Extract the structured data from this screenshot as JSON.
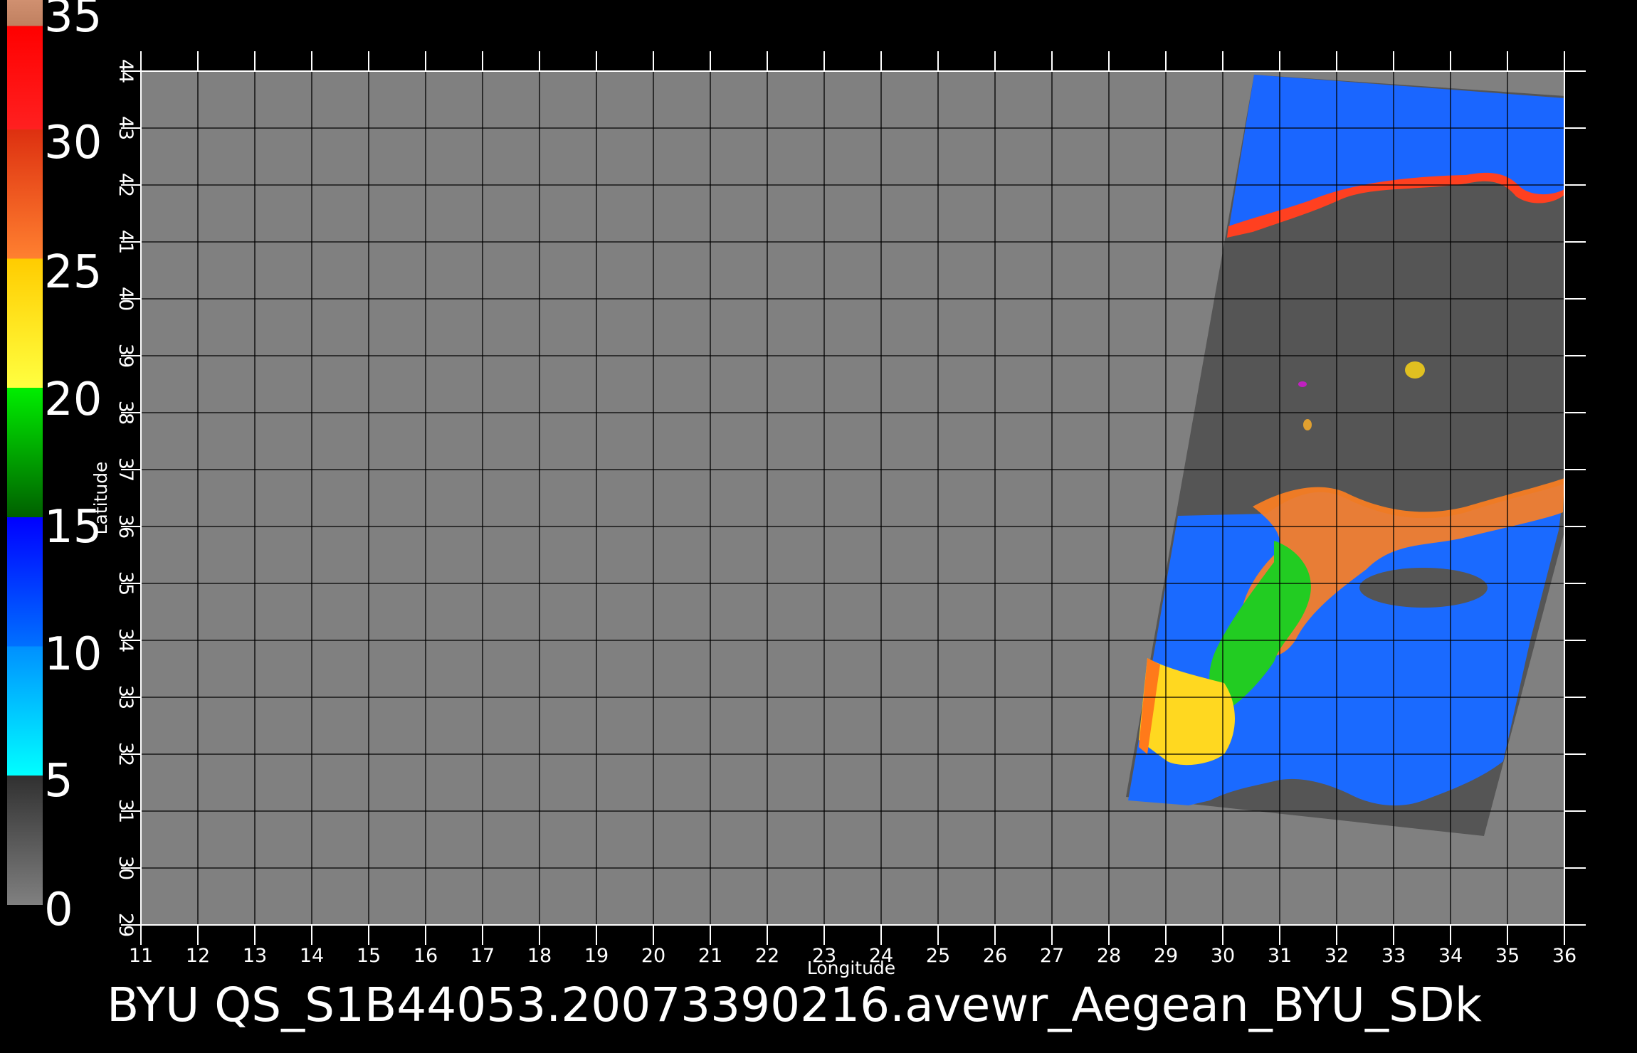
{
  "title": "BYU  QS_S1B44053.20073390216.avewr_Aegean_BYU_SDk",
  "map": {
    "xlabel": "Longitude",
    "ylabel": "Latitude",
    "lon_range": [
      11,
      36
    ],
    "lat_range": [
      29,
      44
    ],
    "lon_ticks": [
      "11",
      "12",
      "13",
      "14",
      "15",
      "16",
      "17",
      "18",
      "19",
      "20",
      "21",
      "22",
      "23",
      "24",
      "25",
      "26",
      "27",
      "28",
      "29",
      "30",
      "31",
      "32",
      "33",
      "34",
      "35",
      "36"
    ],
    "lat_ticks": [
      "29",
      "30",
      "31",
      "32",
      "33",
      "34",
      "35",
      "36",
      "37",
      "38",
      "39",
      "40",
      "41",
      "42",
      "43",
      "44"
    ],
    "background_color": "#808080",
    "swath_nodata_color": "#555555",
    "grid": true
  },
  "colorbar": {
    "labels": [
      "35",
      "30",
      "25",
      "20",
      "15",
      "10",
      "5",
      "0"
    ],
    "range": [
      0,
      35
    ],
    "segments": [
      {
        "from": 0,
        "to": 5,
        "colors": [
          "#808080",
          "#303030"
        ]
      },
      {
        "from": 5,
        "to": 10,
        "colors": [
          "#00ffff",
          "#0090ff"
        ]
      },
      {
        "from": 10,
        "to": 15,
        "colors": [
          "#0070ff",
          "#0000ff"
        ]
      },
      {
        "from": 15,
        "to": 20,
        "colors": [
          "#006000",
          "#00ee00"
        ]
      },
      {
        "from": 20,
        "to": 25,
        "colors": [
          "#ffff40",
          "#ffcc00"
        ]
      },
      {
        "from": 25,
        "to": 30,
        "colors": [
          "#ff8030",
          "#dd3010"
        ]
      },
      {
        "from": 30,
        "to": 34,
        "colors": [
          "#ff2020",
          "#ff0000"
        ]
      },
      {
        "from": 34,
        "to": 35,
        "colors": [
          "#c08060",
          "#d09070"
        ]
      }
    ]
  }
}
